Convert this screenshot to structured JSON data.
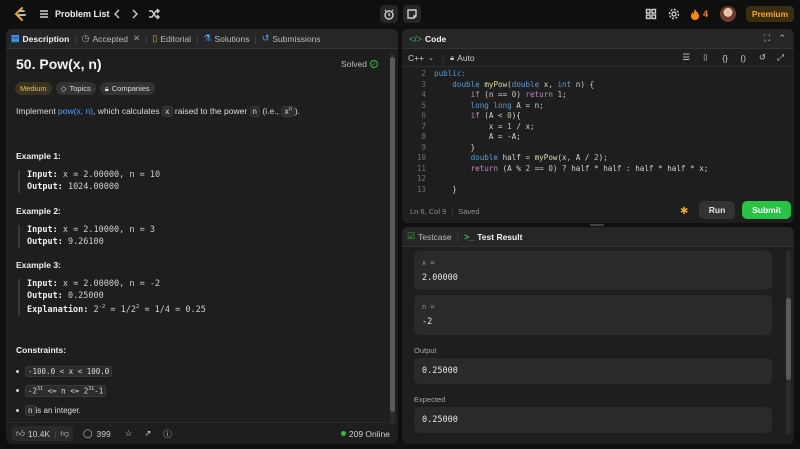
{
  "topbar": {
    "problem_list_label": "Problem List",
    "streak_count": "4",
    "premium_label": "Premium"
  },
  "left_panel": {
    "tabs": [
      {
        "label": "Description",
        "icon": "description-icon"
      },
      {
        "label": "Accepted",
        "icon": "accepted-icon"
      },
      {
        "label": "Editorial",
        "icon": "editorial-icon"
      },
      {
        "label": "Solutions",
        "icon": "solutions-icon"
      },
      {
        "label": "Submissions",
        "icon": "submissions-icon"
      }
    ],
    "title": "50. Pow(x, n)",
    "solved_label": "Solved",
    "tags": {
      "difficulty": "Medium",
      "topics": "Topics",
      "companies": "Companies"
    },
    "desc": {
      "pre": "Implement ",
      "link": "pow(x, n)",
      "mid": ", which calculates ",
      "x": "x",
      "mid2": " raised to the power ",
      "n": "n",
      "post": " (i.e., ",
      "formula": "x",
      "formula_sup": "n",
      "end": ")."
    },
    "examples": [
      {
        "title": "Example 1:",
        "input_label": "Input:",
        "input": " x = 2.00000, n = 10",
        "output_label": "Output:",
        "output": " 1024.00000"
      },
      {
        "title": "Example 2:",
        "input_label": "Input:",
        "input": " x = 2.10000, n = 3",
        "output_label": "Output:",
        "output": " 9.26100"
      },
      {
        "title": "Example 3:",
        "input_label": "Input:",
        "input": " x = 2.00000, n = -2",
        "output_label": "Output:",
        "output": " 0.25000",
        "explanation_label": "Explanation:",
        "explanation_a": " 2",
        "explanation_sup1": "-2",
        "explanation_b": " = 1/2",
        "explanation_sup2": "2",
        "explanation_c": " = 1/4 = 0.25"
      }
    ],
    "constraints_title": "Constraints:",
    "constraints": [
      {
        "a": "-100.0 < x < 100.0"
      },
      {
        "a": "-2",
        "sup1": "31",
        "b": " <= n <= 2",
        "sup2": "31",
        "c": "-1"
      },
      {
        "chip": "n",
        "text": " is an integer."
      }
    ],
    "footer": {
      "likes": "10.4K",
      "comments": "399",
      "online": "209 Online"
    }
  },
  "code_panel": {
    "title": "Code",
    "language": "C++",
    "auto_label": "Auto",
    "status": {
      "position": "Ln 6, Col 9",
      "saved": "Saved"
    },
    "run_label": "Run",
    "submit_label": "Submit",
    "lines": [
      {
        "num": "2",
        "indent": "",
        "tokens": [
          {
            "t": "public:",
            "c": "kw"
          }
        ]
      },
      {
        "num": "3",
        "indent": "    ",
        "tokens": [
          {
            "t": "double ",
            "c": "kw"
          },
          {
            "t": "myPow",
            "c": "fn"
          },
          {
            "t": "(",
            "c": "plain"
          },
          {
            "t": "double ",
            "c": "kw"
          },
          {
            "t": "x, ",
            "c": "plain"
          },
          {
            "t": "int ",
            "c": "kw"
          },
          {
            "t": "n) {",
            "c": "plain"
          }
        ]
      },
      {
        "num": "4",
        "indent": "        ",
        "tokens": [
          {
            "t": "if ",
            "c": "ctl"
          },
          {
            "t": "(n == ",
            "c": "plain"
          },
          {
            "t": "0",
            "c": "num"
          },
          {
            "t": ") ",
            "c": "plain"
          },
          {
            "t": "return ",
            "c": "ctl"
          },
          {
            "t": "1",
            "c": "num"
          },
          {
            "t": ";",
            "c": "plain"
          }
        ]
      },
      {
        "num": "5",
        "indent": "        ",
        "tokens": [
          {
            "t": "long long ",
            "c": "kw"
          },
          {
            "t": "A = n;",
            "c": "plain"
          }
        ]
      },
      {
        "num": "6",
        "indent": "        ",
        "tokens": [
          {
            "t": "if ",
            "c": "ctl"
          },
          {
            "t": "(A < ",
            "c": "plain"
          },
          {
            "t": "0",
            "c": "num"
          },
          {
            "t": "){",
            "c": "plain"
          }
        ]
      },
      {
        "num": "7",
        "indent": "            ",
        "tokens": [
          {
            "t": "x = ",
            "c": "plain"
          },
          {
            "t": "1",
            "c": "num"
          },
          {
            "t": " / x;",
            "c": "plain"
          }
        ]
      },
      {
        "num": "8",
        "indent": "            ",
        "tokens": [
          {
            "t": "A = -A;",
            "c": "plain"
          }
        ]
      },
      {
        "num": "9",
        "indent": "        ",
        "tokens": [
          {
            "t": "}",
            "c": "plain"
          }
        ]
      },
      {
        "num": "10",
        "indent": "        ",
        "tokens": [
          {
            "t": "double ",
            "c": "kw"
          },
          {
            "t": "half = ",
            "c": "plain"
          },
          {
            "t": "myPow",
            "c": "fn"
          },
          {
            "t": "(x, A / ",
            "c": "plain"
          },
          {
            "t": "2",
            "c": "num"
          },
          {
            "t": ");",
            "c": "plain"
          }
        ]
      },
      {
        "num": "11",
        "indent": "        ",
        "tokens": [
          {
            "t": "return ",
            "c": "ctl"
          },
          {
            "t": "(A % ",
            "c": "plain"
          },
          {
            "t": "2",
            "c": "num"
          },
          {
            "t": " == ",
            "c": "plain"
          },
          {
            "t": "0",
            "c": "num"
          },
          {
            "t": ") ? half * half : half * half * x;",
            "c": "plain"
          }
        ]
      },
      {
        "num": "12",
        "indent": "",
        "tokens": []
      },
      {
        "num": "13",
        "indent": "    ",
        "tokens": [
          {
            "t": "}",
            "c": "plain"
          }
        ]
      }
    ]
  },
  "result_panel": {
    "tabs": [
      {
        "label": "Testcase"
      },
      {
        "label": "Test Result"
      }
    ],
    "inputs": [
      {
        "label": "x =",
        "value": "2.00000"
      },
      {
        "label": "n =",
        "value": "-2"
      }
    ],
    "output_label": "Output",
    "output_value": "0.25000",
    "expected_label": "Expected",
    "expected_value": "0.25000"
  },
  "colors": {
    "accent_green": "#28c244",
    "medium": "#f6b93b",
    "link": "#4aa3ff",
    "premium": "#f5a623",
    "flame": "#ff8a00"
  }
}
